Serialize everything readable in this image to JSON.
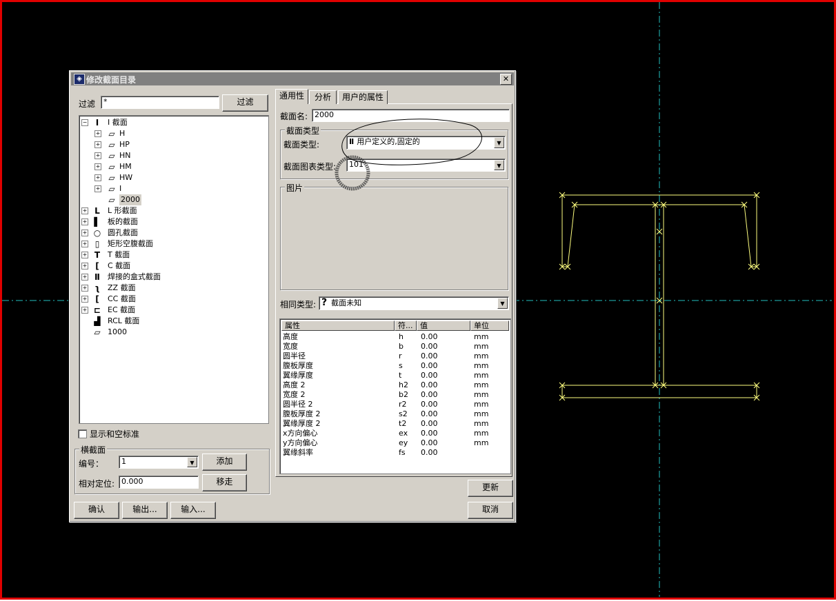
{
  "dialog": {
    "title": "修改截面目录",
    "close_label": "✕"
  },
  "filter": {
    "label": "过滤",
    "value": "*",
    "button_label": "过滤"
  },
  "tree": {
    "expanded": "−",
    "collapsed": "+",
    "items": [
      {
        "label": "I 截面",
        "icon": "i-beam-icon",
        "glyph": "Ⅰ"
      },
      {
        "label": "H",
        "icon": "profile-icon",
        "glyph": "▱"
      },
      {
        "label": "HP",
        "icon": "profile-icon",
        "glyph": "▱"
      },
      {
        "label": "HN",
        "icon": "profile-icon",
        "glyph": "▱"
      },
      {
        "label": "HM",
        "icon": "profile-icon",
        "glyph": "▱"
      },
      {
        "label": "HW",
        "icon": "profile-icon",
        "glyph": "▱"
      },
      {
        "label": "I",
        "icon": "profile-icon",
        "glyph": "▱"
      },
      {
        "label": "2000",
        "icon": "user-profile-icon",
        "glyph": "▱"
      },
      {
        "label": "L 形截面",
        "icon": "l-section-icon",
        "glyph": "L"
      },
      {
        "label": "板的截面",
        "icon": "plate-section-icon",
        "glyph": "▌"
      },
      {
        "label": "圆孔截面",
        "icon": "circular-section-icon",
        "glyph": "○"
      },
      {
        "label": "矩形空腹截面",
        "icon": "rect-hollow-icon",
        "glyph": "▯"
      },
      {
        "label": "T 截面",
        "icon": "t-section-icon",
        "glyph": "T"
      },
      {
        "label": "C 截面",
        "icon": "c-section-icon",
        "glyph": "["
      },
      {
        "label": "焊接的盒式截面",
        "icon": "welded-box-icon",
        "glyph": "Ⅱ"
      },
      {
        "label": "ZZ 截面",
        "icon": "z-section-icon",
        "glyph": "ʅ"
      },
      {
        "label": "CC 截面",
        "icon": "cc-section-icon",
        "glyph": "["
      },
      {
        "label": "EC 截面",
        "icon": "ec-section-icon",
        "glyph": "⊏"
      },
      {
        "label": "RCL 截面",
        "icon": "rcl-section-icon",
        "glyph": "▟"
      },
      {
        "label": "1000",
        "icon": "user-profile-icon",
        "glyph": "▱"
      }
    ]
  },
  "show_empty_label": "显示和空标准",
  "cross_section": {
    "group_label": "横截面",
    "number_label": "编号：",
    "number_value": "1",
    "add_label": "添加",
    "offset_label": "相对定位:",
    "offset_value": "0.000",
    "remove_label": "移走"
  },
  "bottom_buttons": {
    "ok": "确认",
    "export": "输出...",
    "import": "输入...",
    "update": "更新",
    "cancel": "取消"
  },
  "tabs": [
    "通用性",
    "分析",
    "用户的属性"
  ],
  "general": {
    "name_label": "截面名:",
    "name_value": "2000",
    "type_group_label": "截面类型",
    "type_label": "截面类型:",
    "type_value": "用户定义的,固定的",
    "chart_type_label": "截面图表类型:",
    "chart_type_value": "101",
    "picture_label": "图片",
    "same_type_label": "相同类型:",
    "same_type_value": "截面未知",
    "same_type_glyph": "?"
  },
  "props": {
    "headers": [
      "属性",
      "符...",
      "值",
      "单位"
    ],
    "rows": [
      {
        "name": "高度",
        "sym": "h",
        "val": "0.00",
        "unit": "mm"
      },
      {
        "name": "宽度",
        "sym": "b",
        "val": "0.00",
        "unit": "mm"
      },
      {
        "name": "圆半径",
        "sym": "r",
        "val": "0.00",
        "unit": "mm"
      },
      {
        "name": "腹板厚度",
        "sym": "s",
        "val": "0.00",
        "unit": "mm"
      },
      {
        "name": "翼缘厚度",
        "sym": "t",
        "val": "0.00",
        "unit": "mm"
      },
      {
        "name": "高度 2",
        "sym": "h2",
        "val": "0.00",
        "unit": "mm"
      },
      {
        "name": "宽度 2",
        "sym": "b2",
        "val": "0.00",
        "unit": "mm"
      },
      {
        "name": "圆半径 2",
        "sym": "r2",
        "val": "0.00",
        "unit": "mm"
      },
      {
        "name": "腹板厚度 2",
        "sym": "s2",
        "val": "0.00",
        "unit": "mm"
      },
      {
        "name": "翼缘厚度 2",
        "sym": "t2",
        "val": "0.00",
        "unit": "mm"
      },
      {
        "name": "x方向偏心",
        "sym": "ex",
        "val": "0.00",
        "unit": "mm"
      },
      {
        "name": "y方向偏心",
        "sym": "ey",
        "val": "0.00",
        "unit": "mm"
      },
      {
        "name": "翼缘斜率",
        "sym": "fs",
        "val": "0.00",
        "unit": ""
      }
    ]
  },
  "colors": {
    "viewport_bg": "#000000",
    "viewport_border": "#e00000",
    "axis_line": "#22c0c0",
    "profile_line": "#ffff80",
    "dialog_face": "#d4d0c8"
  }
}
